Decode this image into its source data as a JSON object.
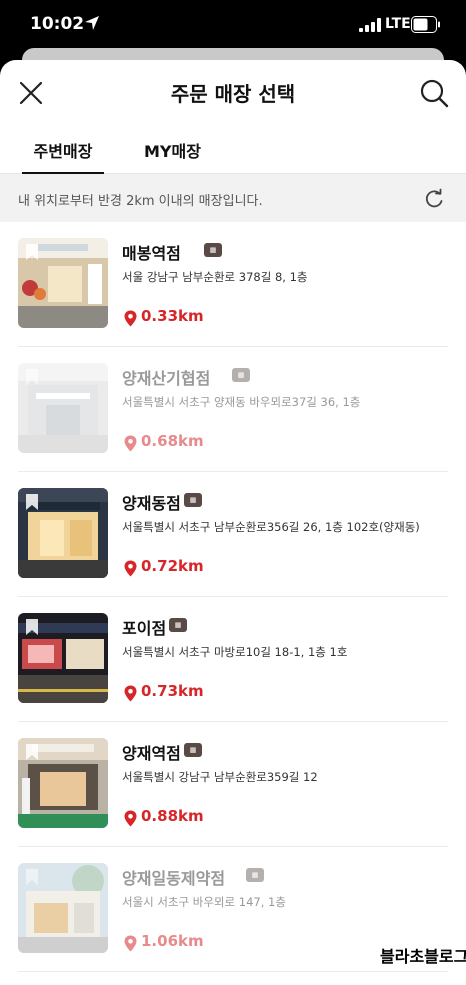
{
  "status": {
    "time": "10:02",
    "network": "LTE"
  },
  "header": {
    "title": "주문 매장 선택"
  },
  "tabs": [
    {
      "label": "주변매장"
    },
    {
      "label": "MY매장"
    }
  ],
  "notice": {
    "text": "내 위치로부터 반경 2km 이내의 매장입니다."
  },
  "stores": [
    {
      "name": "매봉역점",
      "address": "서울 강남구 남부순환로 378길 8, 1층",
      "distance": "0.33km",
      "available": true
    },
    {
      "name": "양재산기협점",
      "address": "서울특별시 서초구 양재동 바우뫼로37길 36, 1층",
      "distance": "0.68km",
      "available": false
    },
    {
      "name": "양재동점",
      "address": "서울특별시 서초구 남부순환로356길 26, 1층 102호(양재동)",
      "distance": "0.72km",
      "available": true
    },
    {
      "name": "포이점",
      "address": "서울특별시 서초구 마방로10길 18-1, 1층 1호",
      "distance": "0.73km",
      "available": true
    },
    {
      "name": "양재역점",
      "address": "서울특별시 강남구 남부순환로359길 12",
      "distance": "0.88km",
      "available": true
    },
    {
      "name": "양재일동제약점",
      "address": "서울시 서초구 바우뫼로 147, 1층",
      "distance": "1.06km",
      "available": false
    }
  ],
  "watermark": "블라초블로그",
  "colors": {
    "accent": "#d7262a",
    "badge": "#5a4a46"
  }
}
